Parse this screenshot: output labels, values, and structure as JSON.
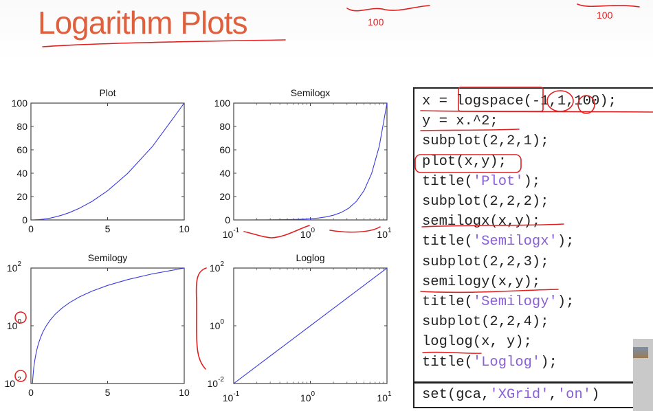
{
  "slide": {
    "title": "Logarithm Plots",
    "title_color": "#e0603e"
  },
  "code": {
    "lines": [
      [
        {
          "t": "x = logspace(-1,1,100);"
        }
      ],
      [
        {
          "t": "y = x.^2;"
        }
      ],
      [
        {
          "t": "subplot(2,2,1);"
        }
      ],
      [
        {
          "t": "plot(x,y);"
        }
      ],
      [
        {
          "t": "title("
        },
        {
          "t": "'Plot'",
          "s": 1
        },
        {
          "t": ");"
        }
      ],
      [
        {
          "t": "subplot(2,2,2);"
        }
      ],
      [
        {
          "t": "semilogx(x,y);"
        }
      ],
      [
        {
          "t": "title("
        },
        {
          "t": "'Semilogx'",
          "s": 1
        },
        {
          "t": ");"
        }
      ],
      [
        {
          "t": "subplot(2,2,3);"
        }
      ],
      [
        {
          "t": "semilogy(x,y);"
        }
      ],
      [
        {
          "t": "title("
        },
        {
          "t": "'Semilogy'",
          "s": 1
        },
        {
          "t": ");"
        }
      ],
      [
        {
          "t": "subplot(2,2,4);"
        }
      ],
      [
        {
          "t": "loglog(x, y);"
        }
      ],
      [
        {
          "t": "title("
        },
        {
          "t": "'Loglog'",
          "s": 1
        },
        {
          "t": ");"
        }
      ]
    ],
    "extra": [
      {
        "t": "set(gca,"
      },
      {
        "t": "'XGrid'",
        "s": 1
      },
      {
        "t": ","
      },
      {
        "t": "'on'",
        "s": 1
      },
      {
        "t": ")"
      }
    ],
    "string_color": "#8a5fd8"
  },
  "annotations": {
    "note1": "100",
    "note2": "100"
  },
  "chart_data": [
    {
      "type": "line",
      "title": "Plot",
      "xscale": "linear",
      "yscale": "linear",
      "xlim": [
        0,
        10
      ],
      "ylim": [
        0,
        100
      ],
      "xticks": [
        {
          "base": "0"
        },
        {
          "base": "5"
        },
        {
          "base": "10"
        }
      ],
      "xtick_values": [
        0,
        5,
        10
      ],
      "yticks": [
        {
          "base": "0"
        },
        {
          "base": "20"
        },
        {
          "base": "40"
        },
        {
          "base": "60"
        },
        {
          "base": "80"
        },
        {
          "base": "100"
        }
      ],
      "ytick_values": [
        0,
        20,
        40,
        60,
        80,
        100
      ],
      "color": "#3a3adf",
      "grid": false
    },
    {
      "type": "line",
      "title": "Semilogx",
      "xscale": "log",
      "yscale": "linear",
      "xlim": [
        0.1,
        10
      ],
      "ylim": [
        0,
        100
      ],
      "xticks": [
        {
          "base": "10",
          "exp": "-1"
        },
        {
          "base": "10",
          "exp": "0"
        },
        {
          "base": "10",
          "exp": "1"
        }
      ],
      "xtick_values": [
        0.1,
        1,
        10
      ],
      "yticks": [
        {
          "base": "0"
        },
        {
          "base": "20"
        },
        {
          "base": "40"
        },
        {
          "base": "60"
        },
        {
          "base": "80"
        },
        {
          "base": "100"
        }
      ],
      "ytick_values": [
        0,
        20,
        40,
        60,
        80,
        100
      ],
      "color": "#3a3adf",
      "grid": false
    },
    {
      "type": "line",
      "title": "Semilogy",
      "xscale": "linear",
      "yscale": "log",
      "xlim": [
        0,
        10
      ],
      "ylim": [
        0.01,
        100
      ],
      "xticks": [
        {
          "base": "0"
        },
        {
          "base": "5"
        },
        {
          "base": "10"
        }
      ],
      "xtick_values": [
        0,
        5,
        10
      ],
      "yticks": [
        {
          "base": "10",
          "exp": "-2"
        },
        {
          "base": "10",
          "exp": "0"
        },
        {
          "base": "10",
          "exp": "2"
        }
      ],
      "ytick_values": [
        0.01,
        1,
        100
      ],
      "color": "#3a3adf",
      "grid": false
    },
    {
      "type": "line",
      "title": "Loglog",
      "xscale": "log",
      "yscale": "log",
      "xlim": [
        0.1,
        10
      ],
      "ylim": [
        0.01,
        100
      ],
      "xticks": [
        {
          "base": "10",
          "exp": "-1"
        },
        {
          "base": "10",
          "exp": "0"
        },
        {
          "base": "10",
          "exp": "1"
        }
      ],
      "xtick_values": [
        0.1,
        1,
        10
      ],
      "yticks": [
        {
          "base": "10",
          "exp": "-2"
        },
        {
          "base": "10",
          "exp": "0"
        },
        {
          "base": "10",
          "exp": "2"
        }
      ],
      "ytick_values": [
        0.01,
        1,
        100
      ],
      "color": "#3a3adf",
      "grid": false
    }
  ],
  "series": {
    "x": [
      0.1,
      0.1259,
      0.1585,
      0.1995,
      0.2512,
      0.3162,
      0.3981,
      0.5012,
      0.631,
      0.7943,
      1,
      1.259,
      1.585,
      1.995,
      2.512,
      3.162,
      3.981,
      5.012,
      6.31,
      7.943,
      10
    ],
    "y": [
      0.01,
      0.01585,
      0.02512,
      0.03981,
      0.0631,
      0.1,
      0.1585,
      0.2512,
      0.3981,
      0.631,
      1,
      1.585,
      2.512,
      3.981,
      6.31,
      10,
      15.85,
      25.12,
      39.81,
      63.1,
      100
    ]
  }
}
